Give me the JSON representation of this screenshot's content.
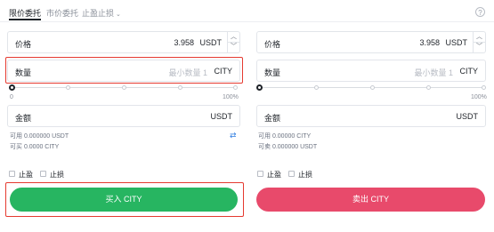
{
  "tabs": {
    "limit": "限价委托",
    "market": "市价委托",
    "tpsl": "止盈止损"
  },
  "help_glyph": "?",
  "buy": {
    "price_label": "价格",
    "price_value": "3.958",
    "price_unit": "USDT",
    "qty_label": "数量",
    "qty_placeholder": "最小数量 1",
    "qty_unit": "CITY",
    "slider_min": "0",
    "slider_max": "100%",
    "amount_label": "金额",
    "amount_unit": "USDT",
    "available": "可用 0.000000 USDT",
    "buyable": "可买 0.0000 CITY",
    "take_profit": "止盈",
    "stop_loss": "止损",
    "button": "买入 CITY"
  },
  "sell": {
    "price_label": "价格",
    "price_value": "3.958",
    "price_unit": "USDT",
    "qty_label": "数量",
    "qty_placeholder": "最小数量 1",
    "qty_unit": "CITY",
    "slider_max": "100%",
    "amount_label": "金额",
    "amount_unit": "USDT",
    "available": "可用 0.00000 CITY",
    "sellable": "可卖 0.000000 USDT",
    "take_profit": "止盈",
    "stop_loss": "止损",
    "button": "卖出 CITY"
  },
  "colors": {
    "buy": "#27b561",
    "sell": "#e84a6b",
    "highlight": "#e53a30"
  }
}
